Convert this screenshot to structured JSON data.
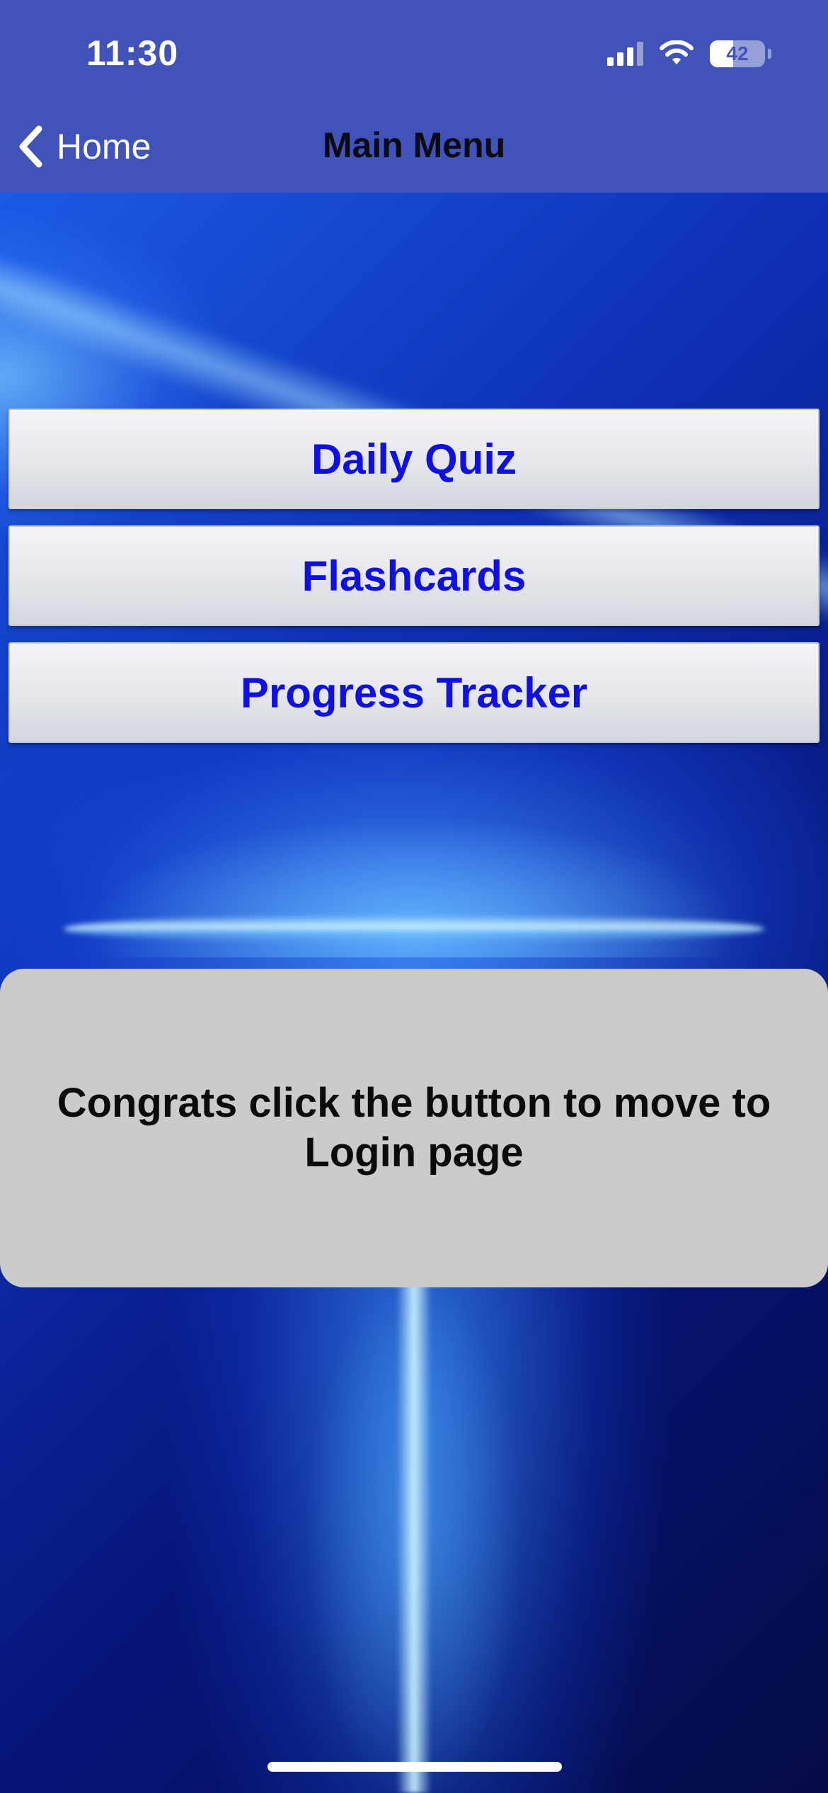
{
  "status_bar": {
    "time": "11:30",
    "battery_percent": "42"
  },
  "nav": {
    "back_label": "Home",
    "title": "Main Menu"
  },
  "menu": {
    "buttons": [
      {
        "label": "Daily Quiz"
      },
      {
        "label": "Flashcards"
      },
      {
        "label": "Progress Tracker"
      }
    ]
  },
  "message": {
    "text": "Congrats click the button to move to Login page"
  },
  "colors": {
    "header_bg": "#4152b9",
    "button_text": "#1010e0",
    "card_bg": "#cbcbcb"
  },
  "icons": {
    "back": "chevron-left-icon",
    "signal": "cellular-signal-icon",
    "wifi": "wifi-icon",
    "battery": "battery-icon"
  }
}
